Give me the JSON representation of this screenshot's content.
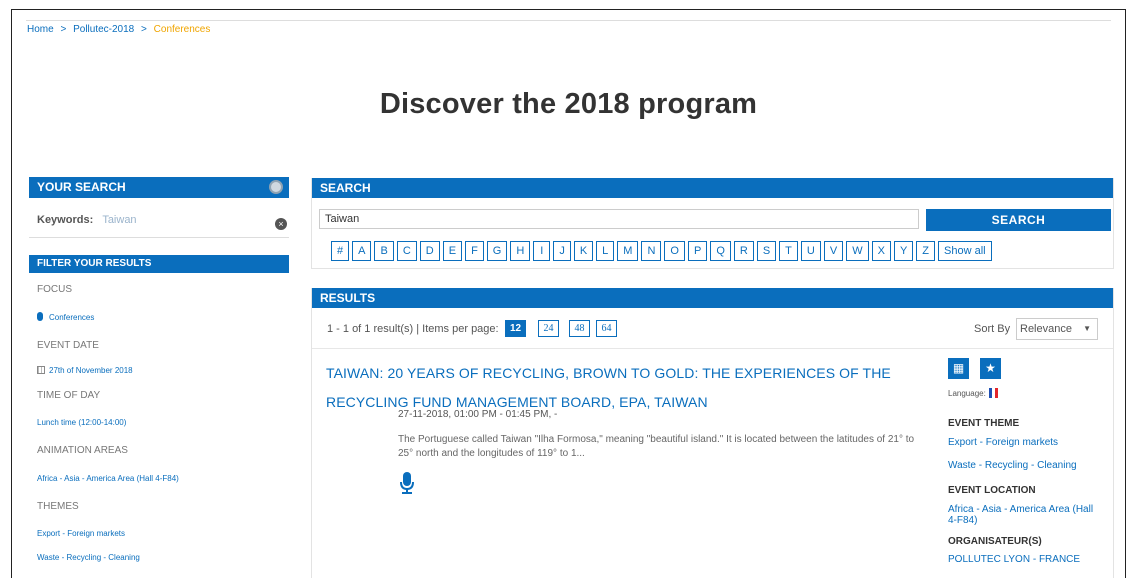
{
  "breadcrumb": {
    "home": "Home",
    "event": "Pollutec-2018",
    "current": "Conferences",
    "sep": ">"
  },
  "page_title": "Discover the 2018 program",
  "left": {
    "your_search": "YOUR SEARCH",
    "keywords_label": "Keywords:",
    "keywords_value": "Taiwan",
    "filter_title": "FILTER YOUR RESULTS",
    "sections": {
      "focus": "FOCUS",
      "focus_item": "Conferences",
      "event_date": "EVENT DATE",
      "event_date_item": "27th of November 2018",
      "time_of_day": "TIME OF DAY",
      "time_of_day_item": "Lunch time (12:00-14:00)",
      "animation_areas": "ANIMATION AREAS",
      "animation_areas_item": "Africa - Asia - America Area (Hall 4-F84)",
      "themes": "THEMES",
      "themes_item1": "Export - Foreign markets",
      "themes_item2": "Waste - Recycling - Cleaning"
    }
  },
  "search": {
    "title": "SEARCH",
    "input_value": "Taiwan",
    "button": "SEARCH",
    "letters": [
      "#",
      "A",
      "B",
      "C",
      "D",
      "E",
      "F",
      "G",
      "H",
      "I",
      "J",
      "K",
      "L",
      "M",
      "N",
      "O",
      "P",
      "Q",
      "R",
      "S",
      "T",
      "U",
      "V",
      "W",
      "X",
      "Y",
      "Z",
      "Show all"
    ]
  },
  "results": {
    "title": "RESULTS",
    "count_text": "1 - 1 of 1 result(s) | Items per page:",
    "per_page": [
      "12",
      "24",
      "48",
      "64"
    ],
    "sort_label": "Sort By",
    "sort_value": "Relevance",
    "event": {
      "title": "TAIWAN: 20 YEARS OF RECYCLING, BROWN TO GOLD: THE EXPERIENCES OF THE RECYCLING FUND MANAGEMENT BOARD, EPA, TAIWAN",
      "date": "27-11-2018, 01:00 PM - 01:45 PM, -",
      "description": "The Portuguese called Taiwan \"Ilha Formosa,\" meaning \"beautiful island.\" It is located between the latitudes of 21° to 25° north and the longitudes of 119° to 1...",
      "language_label": "Language:",
      "event_theme_label": "EVENT THEME",
      "theme1": "Export - Foreign markets",
      "theme2": "Waste - Recycling - Cleaning",
      "event_location_label": "EVENT LOCATION",
      "location": "Africa - Asia - America Area (Hall 4-F84)",
      "organisers_label": "ORGANISATEUR(S)",
      "organiser": "POLLUTEC LYON - FRANCE"
    }
  },
  "colors": {
    "primary": "#0a6ebd",
    "accent": "#f0a500"
  }
}
